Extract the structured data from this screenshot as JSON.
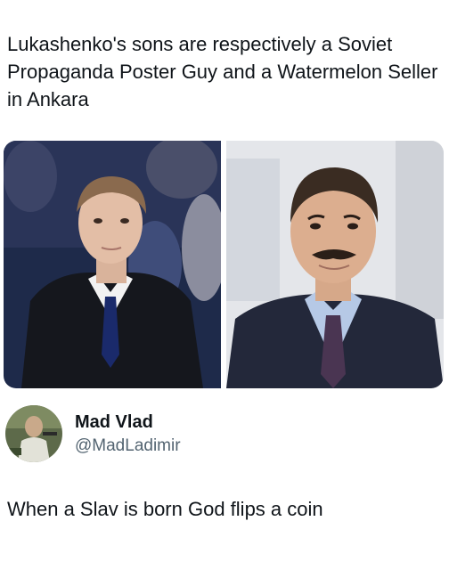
{
  "post": {
    "text": "Lukashenko's sons are respectively a Soviet Propaganda Poster Guy and a Watermelon Seller in Ankara"
  },
  "photos": [
    {
      "icon": "young-man-in-suit-photo"
    },
    {
      "icon": "mustached-man-in-suit-photo"
    }
  ],
  "author": {
    "display_name": "Mad Vlad",
    "handle": "@MadLadimir",
    "avatar_icon": "avatar-photo"
  },
  "reply": {
    "text": "When a Slav is born God flips a coin"
  }
}
